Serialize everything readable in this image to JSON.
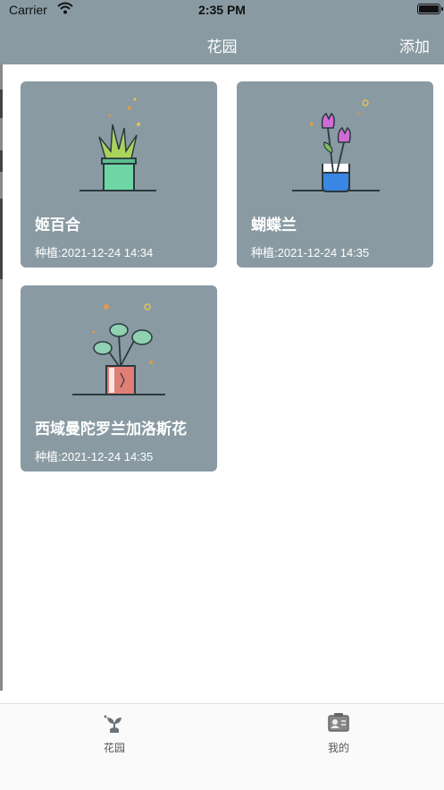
{
  "status_bar": {
    "carrier": "Carrier",
    "time": "2:35 PM"
  },
  "nav": {
    "title": "花园",
    "add_label": "添加"
  },
  "plants": [
    {
      "name": "姬百合",
      "planted": "种植:2021-12-24 14:34",
      "icon": "snake-plant-pot-icon"
    },
    {
      "name": "蝴蝶兰",
      "planted": "种植:2021-12-24 14:35",
      "icon": "tulip-vase-icon"
    },
    {
      "name": "西域曼陀罗兰加洛斯花",
      "planted": "种植:2021-12-24 14:35",
      "icon": "monstera-pot-icon"
    }
  ],
  "tabs": [
    {
      "label": "花园",
      "icon": "plant-sprout-icon",
      "active": true
    },
    {
      "label": "我的",
      "icon": "profile-card-icon",
      "active": false
    }
  ],
  "colors": {
    "nav_background": "#899aa3",
    "card_background": "#899aa3",
    "text_on_card": "#ffffff"
  }
}
